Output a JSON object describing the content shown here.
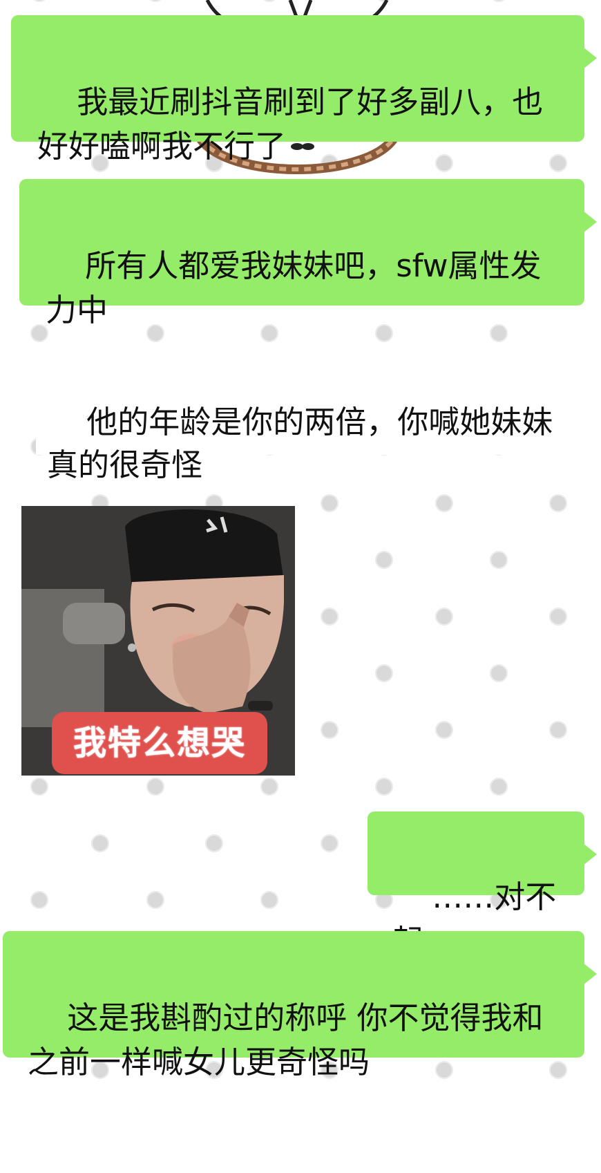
{
  "messages": [
    {
      "id": "m1",
      "text": "我最近刷抖音刷到了好多副八，也好好嗑啊我不行了"
    },
    {
      "id": "m2",
      "text": "所有人都爱我妹妹吧，sfw属性发力中"
    },
    {
      "id": "m3",
      "text": "他的年龄是你的两倍，你喊她妹妹真的很奇怪"
    },
    {
      "id": "m4",
      "text": "……对不起"
    },
    {
      "id": "m5",
      "text": "这是我斟酌过的称呼 你不觉得我和之前一样喊女儿更奇怪吗"
    }
  ],
  "sticker": {
    "caption": "我特么想哭",
    "icon": "crying-man-sticker"
  },
  "colors": {
    "sent_bubble": "#95ec69",
    "background": "#ffffff",
    "dot": "#d9d9d9",
    "sticker_caption_bg": "#e0504d"
  }
}
